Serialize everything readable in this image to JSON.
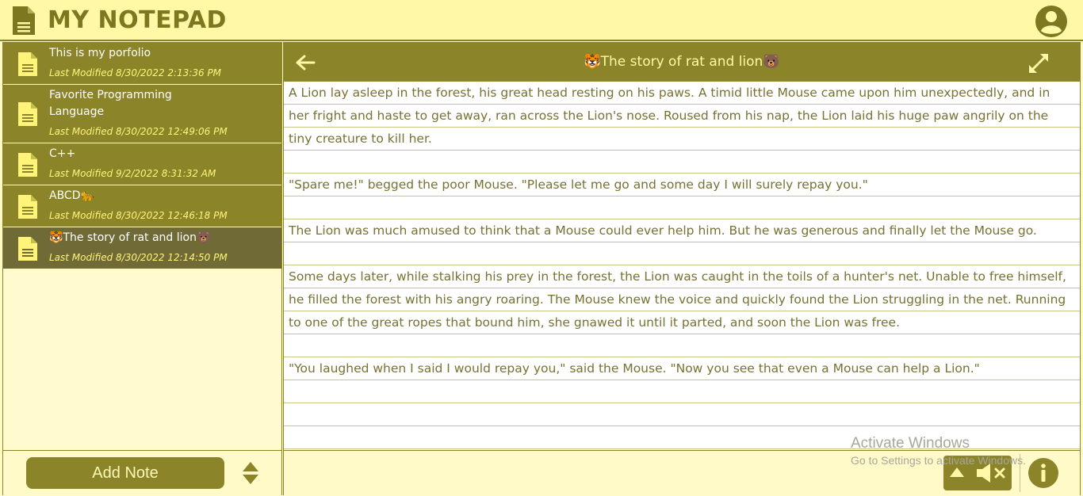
{
  "app": {
    "title": "MY NOTEPAD",
    "logo_icon": "document-icon",
    "account_icon": "user-circle-icon"
  },
  "colors": {
    "accent": "#8b8428",
    "active_item": "#6f6a36",
    "background": "#fffac8",
    "title_text": "#fff8a6",
    "body_text": "#777132"
  },
  "sidebar": {
    "notes": [
      {
        "title": "This is my porfolio",
        "modified": "Last Modified 8/30/2022 2:13:36 PM",
        "active": false
      },
      {
        "title": "Favorite Programming Language",
        "modified": "Last Modified 8/30/2022 12:49:06 PM",
        "active": false
      },
      {
        "title": "C++",
        "modified": "Last Modified 9/2/2022 8:31:32 AM",
        "active": false
      },
      {
        "title": "ABCD🐆",
        "modified": "Last Modified 8/30/2022 12:46:18 PM",
        "active": false
      },
      {
        "title": "🐯The story of rat and lion🐻",
        "modified": "Last Modified 8/30/2022 12:14:50 PM",
        "active": true
      }
    ],
    "add_note_label": "Add Note",
    "sort_icon": "sort-up-down-icon"
  },
  "editor": {
    "title": "🐯The story of rat and lion🐻",
    "back_icon": "arrow-left-icon",
    "expand_icon": "expand-icon",
    "lines": [
      "A Lion lay asleep in the forest, his great head resting on his paws. A timid little Mouse came upon him unexpectedly, and in",
      "her fright and haste to get away, ran across the Lion's nose. Roused from his nap, the Lion laid his huge paw angrily on the",
      "tiny creature to kill her.",
      "",
      "\"Spare me!\" begged the poor Mouse. \"Please let me go and some day I will surely repay you.\"",
      "",
      "The Lion was much amused to think that a Mouse could ever help him. But he was generous and finally let the Mouse go.",
      "",
      "Some days later, while stalking his prey in the forest, the Lion was caught in the toils of a hunter's net. Unable to free himself,",
      "he filled the forest with his angry roaring. The Mouse knew the voice and quickly found the Lion struggling in the net. Running",
      "to one of the great ropes that bound him, she gnawed it until it parted, and soon the Lion was free.",
      "",
      "\"You laughed when I said I would repay you,\" said the Mouse. \"Now you see that even a Mouse can help a Lion.\"",
      "",
      "",
      ""
    ],
    "footer": {
      "scroll_up_icon": "caret-up-icon",
      "mute_icon": "speaker-mute-icon",
      "info_icon": "info-icon"
    }
  },
  "watermark": {
    "title": "Activate Windows",
    "subtitle": "Go to Settings to activate Windows."
  }
}
